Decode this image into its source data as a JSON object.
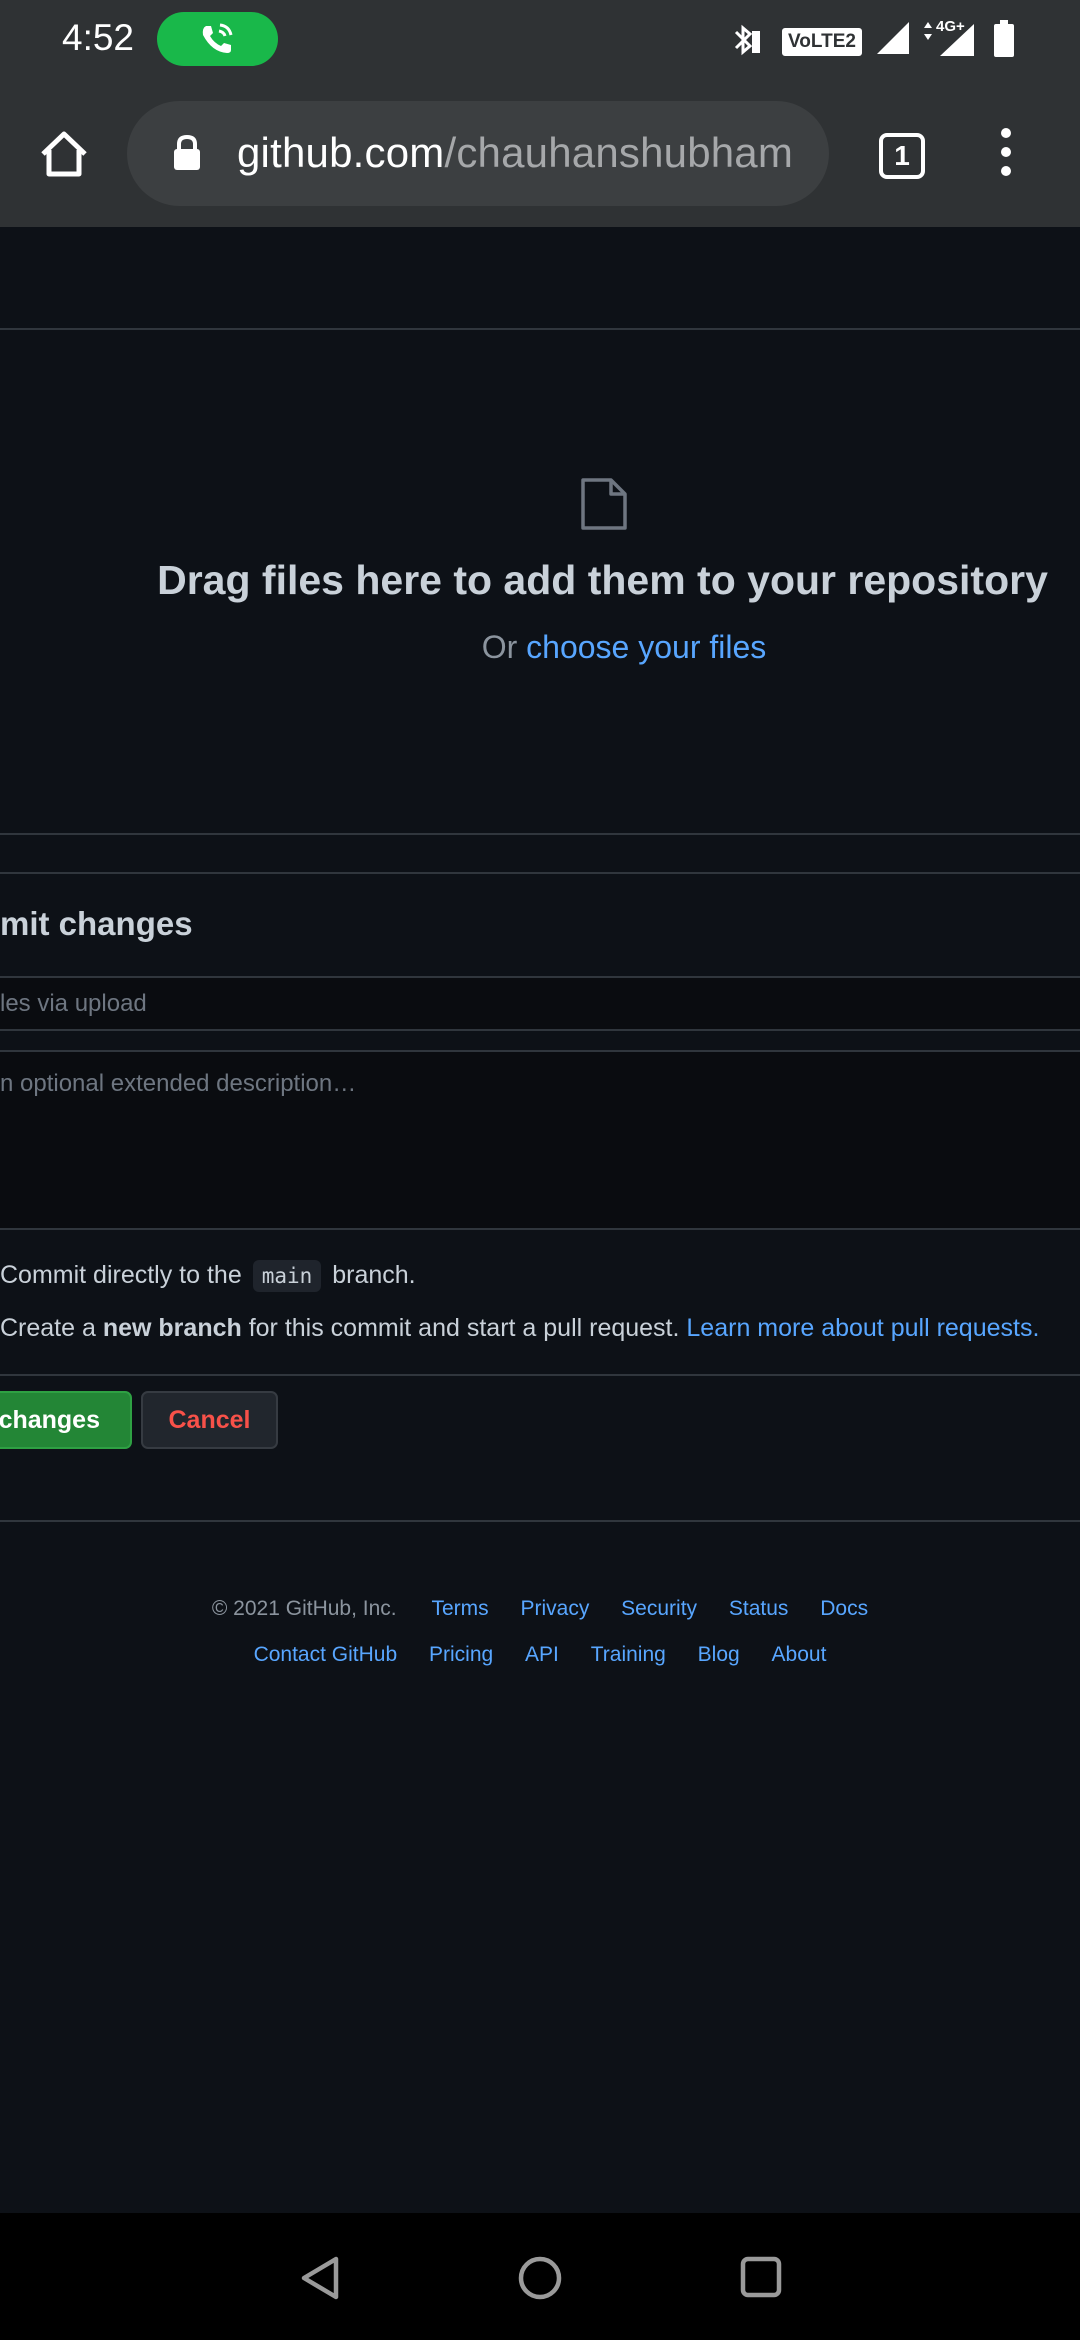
{
  "status_bar": {
    "time": "4:52",
    "network": "VoLTE2",
    "signal_label": "4G+"
  },
  "browser": {
    "url_host": "github.com",
    "url_path": "/chauhanshubham",
    "tab_count": "1"
  },
  "upload": {
    "title": "Drag files here to add them to your repository",
    "or_text": "Or ",
    "choose_link": "choose your files"
  },
  "commit": {
    "heading": "mit changes",
    "summary_placeholder": "les via upload",
    "description_placeholder": "n optional extended description…",
    "option_direct_pre": "Commit directly to the ",
    "branch_name": "main",
    "option_direct_post": " branch.",
    "option_new_pre": "Create a ",
    "option_new_bold": "new branch",
    "option_new_post": " for this commit and start a pull request. ",
    "learn_more_link": "Learn more about pull requests.",
    "commit_button": "changes",
    "cancel_button": "Cancel"
  },
  "footer": {
    "copyright": "© 2021 GitHub, Inc.",
    "links_row1": [
      "Terms",
      "Privacy",
      "Security",
      "Status",
      "Docs"
    ],
    "links_row2": [
      "Contact GitHub",
      "Pricing",
      "API",
      "Training",
      "Blog",
      "About"
    ]
  }
}
